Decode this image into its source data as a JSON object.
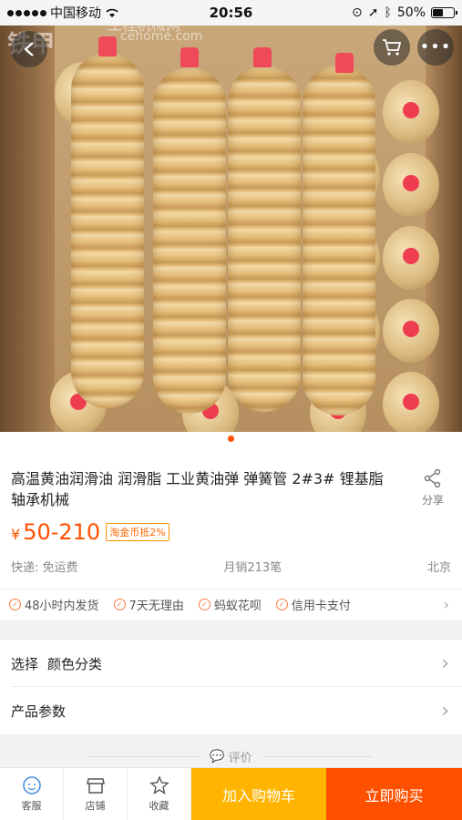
{
  "status_bar": {
    "carrier": "中国移动",
    "time": "20:56",
    "battery_text": "50%",
    "battery_level": 0.5
  },
  "watermark": {
    "logo": "铁甲",
    "site": "工程机械网",
    "url": "cehome.com"
  },
  "product": {
    "title": "高温黄油润滑油 润滑脂 工业黄油弹 弹簧管 2#3# 锂基脂 轴承机械",
    "share_label": "分享",
    "price_symbol": "¥",
    "price": "50-210",
    "coin_badge": "淘金币抵2%",
    "shipping": "快递: 免运费",
    "monthly_sales": "月销213笔",
    "location": "北京"
  },
  "services": [
    "48小时内发货",
    "7天无理由",
    "蚂蚁花呗",
    "信用卡支付"
  ],
  "options": {
    "select_label": "选择",
    "select_value": "颜色分类",
    "params_label": "产品参数"
  },
  "reviews_label": "评价",
  "bottom_bar": {
    "service": "客服",
    "shop": "店铺",
    "favorite": "收藏",
    "add_to_cart": "加入购物车",
    "buy_now": "立即购买"
  },
  "colors": {
    "accent": "#ff5000",
    "cart_button": "#ffb400"
  }
}
